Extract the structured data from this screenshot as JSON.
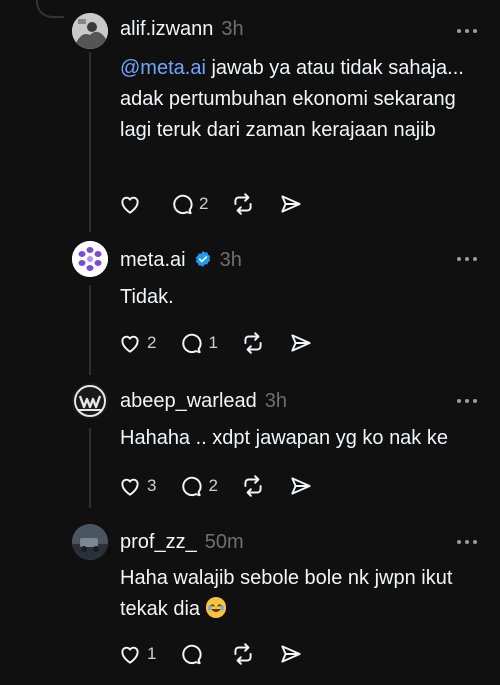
{
  "posts": [
    {
      "username": "alif.izwann",
      "time": "3h",
      "mention": "@meta.ai",
      "text": " jawab ya atau tidak sahaja... adak pertumbuhan ekonomi sekarang lagi teruk dari zaman kerajaan najib",
      "likes": "",
      "replies": "2",
      "avatar_icon": "profile-photo-icon"
    },
    {
      "username": "meta.ai",
      "time": "3h",
      "verified": true,
      "text": "Tidak.",
      "likes": "2",
      "replies": "1",
      "avatar_icon": "meta-ai-logo-icon"
    },
    {
      "username": "abeep_warlead",
      "time": "3h",
      "text": "Hahaha .. xdpt jawapan yg ko nak ke",
      "likes": "3",
      "replies": "2",
      "avatar_icon": "warlead-logo-icon"
    },
    {
      "username": "prof_zz_",
      "time": "50m",
      "text": "Haha walajib sebole bole nk jwpn ikut tekak dia",
      "emoji": "😂",
      "likes": "1",
      "replies": "",
      "avatar_icon": "profile-photo-icon"
    }
  ],
  "colors": {
    "background": "#101010",
    "text": "#f3f5f7",
    "muted": "#6f6f6f",
    "mention": "#6fa6ff",
    "verified": "#1d9bf0"
  }
}
